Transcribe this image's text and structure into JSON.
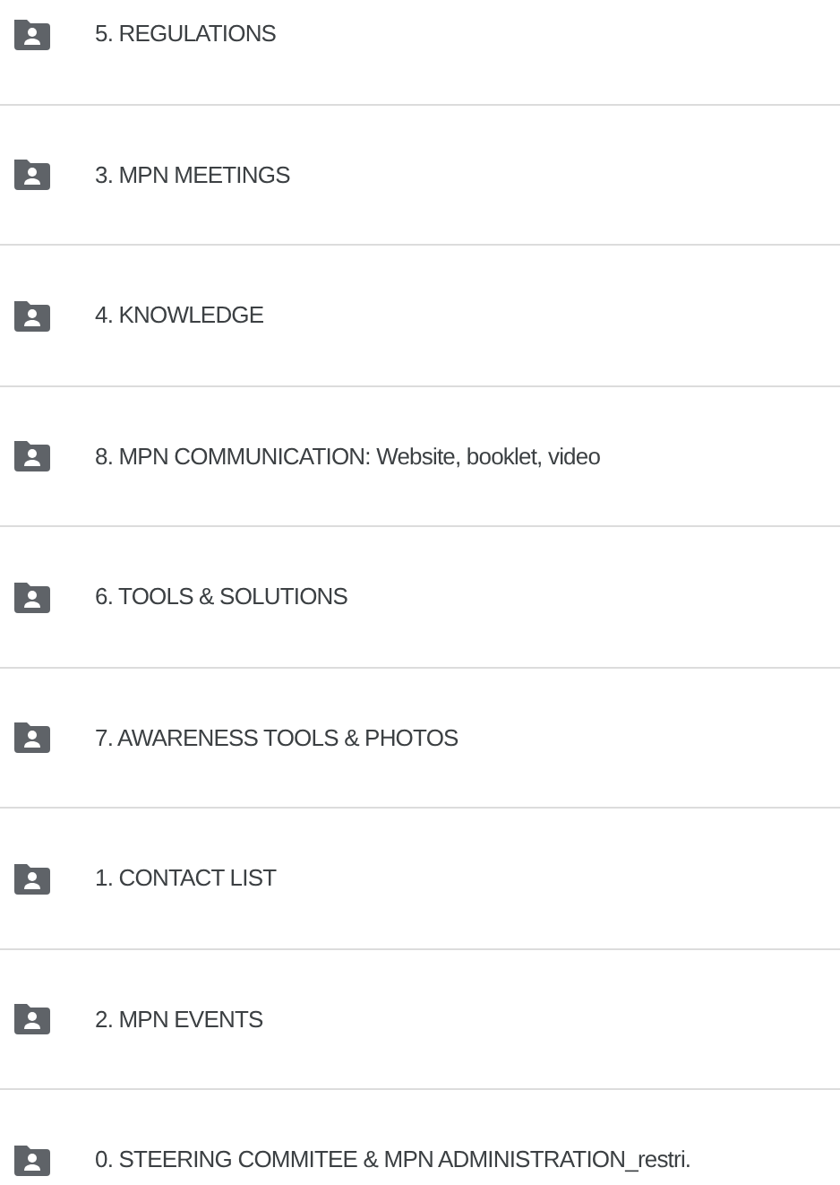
{
  "folders": [
    {
      "name": "5. REGULATIONS"
    },
    {
      "name": "3. MPN MEETINGS"
    },
    {
      "name": "4. KNOWLEDGE"
    },
    {
      "name": "8. MPN COMMUNICATION: Website, booklet, video"
    },
    {
      "name": "6. TOOLS & SOLUTIONS"
    },
    {
      "name": "7. AWARENESS TOOLS & PHOTOS"
    },
    {
      "name": "1. CONTACT LIST"
    },
    {
      "name": "2. MPN EVENTS"
    },
    {
      "name": "0. STEERING COMMITEE & MPN ADMINISTRATION_restri."
    }
  ]
}
